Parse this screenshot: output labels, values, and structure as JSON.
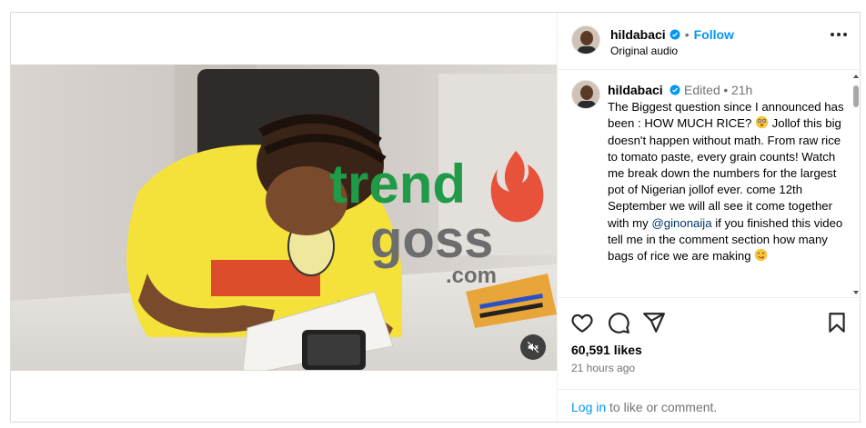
{
  "post": {
    "username": "hildabaci",
    "follow_label": "Follow",
    "dot": "•",
    "audio_label": "Original audio",
    "edited_label": "Edited",
    "timestamp_short": "21h",
    "caption_part1": "The Biggest question since I announced has been : HOW MUCH RICE?",
    "caption_part2": "Jollof this big doesn't happen without math. From raw rice to tomato paste, every grain counts! Watch me break down the numbers for the largest pot of Nigerian jollof ever.  come 12th September we will all see it come together with my",
    "mention": "@ginonaija",
    "caption_part3": "if you finished this video tell me in the comment section how many bags of rice we are making",
    "likes": "60,591 likes",
    "time_ago": "21 hours ago",
    "login_link": "Log in",
    "login_rest": "to like or comment."
  },
  "watermark": {
    "line1": "trend",
    "line2": "goss",
    "line3": ".com"
  },
  "colors": {
    "accent": "#0095f6",
    "watermark_green": "#1f9a46",
    "watermark_gray": "#6d6d6d",
    "watermark_flame": "#e8513a",
    "shirt": "#f4e23a"
  },
  "icons": [
    "verified-icon",
    "more-options-icon",
    "mute-icon",
    "heart-icon",
    "comment-icon",
    "share-icon",
    "bookmark-icon",
    "flushed-emoji-icon",
    "yum-emoji-icon"
  ]
}
